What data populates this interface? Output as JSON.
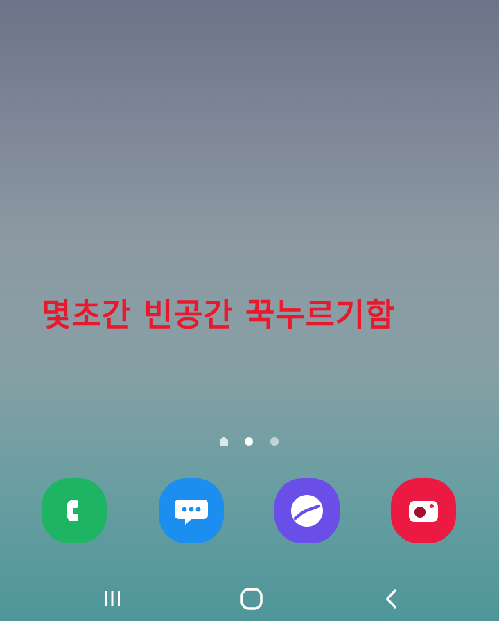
{
  "overlay": {
    "text": "몇초간 빈공간 꾹누르기함",
    "color": "#e8192c"
  },
  "page_indicator": {
    "pages": [
      "home",
      "page-1",
      "page-2"
    ],
    "active_index": 1
  },
  "dock": {
    "apps": [
      {
        "name": "phone",
        "icon": "phone-handset-icon",
        "color": "#1db564"
      },
      {
        "name": "messages",
        "icon": "speech-bubble-icon",
        "color": "#1c8ef0"
      },
      {
        "name": "internet",
        "icon": "browser-orbit-icon",
        "color": "#6a4ee8"
      },
      {
        "name": "camera",
        "icon": "camera-icon",
        "color": "#ec1943"
      }
    ]
  },
  "navigation_bar": {
    "buttons": [
      {
        "name": "recents",
        "icon": "recents-icon"
      },
      {
        "name": "home",
        "icon": "home-rounded-square-icon"
      },
      {
        "name": "back",
        "icon": "back-chevron-icon"
      }
    ]
  }
}
